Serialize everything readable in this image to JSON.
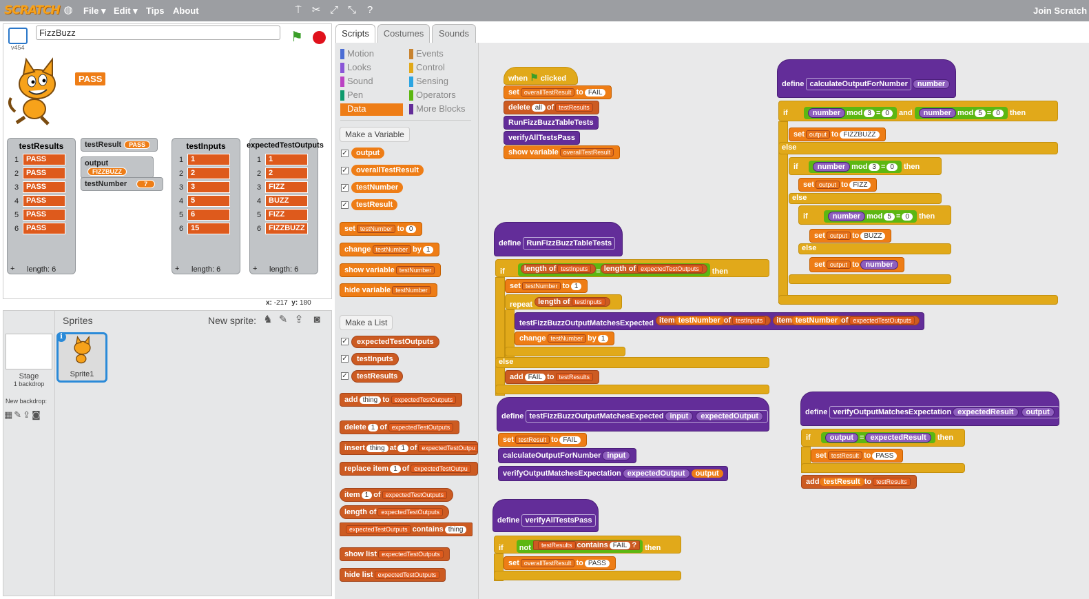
{
  "app": {
    "logo": "SCRATCH",
    "menu": [
      "File ▾",
      "Edit ▾",
      "Tips",
      "About"
    ],
    "join": "Join Scratch"
  },
  "stage": {
    "project_name": "FizzBuzz",
    "version": "v454",
    "speech": "PASS",
    "coords_x_label": "x:",
    "coords_x": "-217",
    "coords_y_label": "y:",
    "coords_y": "180"
  },
  "monitors": {
    "testResults": {
      "title": "testResults",
      "items": [
        "PASS",
        "PASS",
        "PASS",
        "PASS",
        "PASS",
        "PASS"
      ],
      "length": "length: 6"
    },
    "testInputs": {
      "title": "testInputs",
      "items": [
        "1",
        "2",
        "3",
        "5",
        "6",
        "15"
      ],
      "length": "length: 6"
    },
    "expectedTestOutputs": {
      "title": "expectedTestOutputs",
      "items": [
        "1",
        "2",
        "FIZZ",
        "BUZZ",
        "FIZZ",
        "FIZZBUZZ"
      ],
      "length": "length: 6"
    },
    "vars": [
      {
        "name": "testResult",
        "value": "PASS"
      },
      {
        "name": "output",
        "value": "FIZZBUZZ"
      },
      {
        "name": "testNumber",
        "value": "7"
      }
    ]
  },
  "sprites": {
    "title": "Sprites",
    "new_sprite": "New sprite:",
    "stage_label": "Stage",
    "stage_sub": "1 backdrop",
    "new_backdrop": "New backdrop:",
    "sprite1": "Sprite1"
  },
  "tabs": [
    "Scripts",
    "Costumes",
    "Sounds"
  ],
  "categories": [
    {
      "name": "Motion",
      "color": "#4a6cd4"
    },
    {
      "name": "Events",
      "color": "#c88330"
    },
    {
      "name": "Looks",
      "color": "#8a55d7"
    },
    {
      "name": "Control",
      "color": "#e1a91a"
    },
    {
      "name": "Sound",
      "color": "#bb42c3"
    },
    {
      "name": "Sensing",
      "color": "#2ca5e2"
    },
    {
      "name": "Pen",
      "color": "#0e9a6c"
    },
    {
      "name": "Operators",
      "color": "#5cb712"
    },
    {
      "name": "Data",
      "color": "#ee7d16"
    },
    {
      "name": "More Blocks",
      "color": "#632d99"
    }
  ],
  "palette": {
    "make_variable": "Make a Variable",
    "variables": [
      "output",
      "overallTestResult",
      "testNumber",
      "testResult"
    ],
    "var_blocks": [
      {
        "a": "set",
        "b": "testNumber",
        "c": "to",
        "d": "0"
      },
      {
        "a": "change",
        "b": "testNumber",
        "c": "by",
        "d": "1"
      },
      {
        "a": "show variable",
        "b": "testNumber"
      },
      {
        "a": "hide variable",
        "b": "testNumber"
      }
    ],
    "make_list": "Make a List",
    "lists": [
      "expectedTestOutputs",
      "testInputs",
      "testResults"
    ],
    "list_blocks": [
      {
        "a": "add",
        "b": "thing",
        "c": "to",
        "d": "expectedTestOutputs"
      },
      {
        "a": "delete",
        "b": "1",
        "c": "of",
        "d": "expectedTestOutputs"
      },
      {
        "a": "insert",
        "b": "thing",
        "c": "at",
        "d": "1",
        "e": "of",
        "f": "expectedTestOutpu"
      },
      {
        "a": "replace item",
        "b": "1",
        "c": "of",
        "d": "expectedTestOutpu"
      },
      {
        "a": "item",
        "b": "1",
        "c": "of",
        "d": "expectedTestOutputs"
      },
      {
        "a": "length of",
        "b": "expectedTestOutputs"
      },
      {
        "a": "expectedTestOutputs",
        "b": "contains",
        "c": "thing"
      },
      {
        "a": "show list",
        "b": "expectedTestOutputs"
      },
      {
        "a": "hide list",
        "b": "expectedTestOutputs"
      }
    ]
  },
  "scripts": {
    "when": "when",
    "clicked": "clicked",
    "set": "set",
    "to": "to",
    "delete": "delete",
    "of": "of",
    "all": "all",
    "overallTestResult": "overallTestResult",
    "FAIL": "FAIL",
    "PASS": "PASS",
    "testResults": "testResults",
    "RunFizzBuzzTableTests": "RunFizzBuzzTableTests",
    "verifyAllTestsPass": "verifyAllTestsPass",
    "show_variable": "show variable",
    "define": "define",
    "calculateOutputForNumber": "calculateOutputForNumber",
    "number": "number",
    "mod": "mod",
    "and": "and",
    "then": "then",
    "if": "if",
    "else": "else",
    "n3": "3",
    "n5": "5",
    "n0": "0",
    "n1": "1",
    "output": "output",
    "FIZZBUZZ": "FIZZBUZZ",
    "FIZZ": "FIZZ",
    "BUZZ": "BUZZ",
    "length": "length",
    "testInputs": "testInputs",
    "expectedTestOutputs": "expectedTestOutputs",
    "testNumber": "testNumber",
    "repeat": "repeat",
    "testFizzBuzzOutputMatchesExpected": "testFizzBuzzOutputMatchesExpected",
    "item": "item",
    "change": "change",
    "by": "by",
    "add": "add",
    "input": "input",
    "expectedOutput": "expectedOutput",
    "testResult": "testResult",
    "verifyOutputMatchesExpectation": "verifyOutputMatchesExpectation",
    "expectedResult": "expectedResult",
    "not": "not",
    "contains": "contains",
    "q": "?",
    "eq": "="
  }
}
